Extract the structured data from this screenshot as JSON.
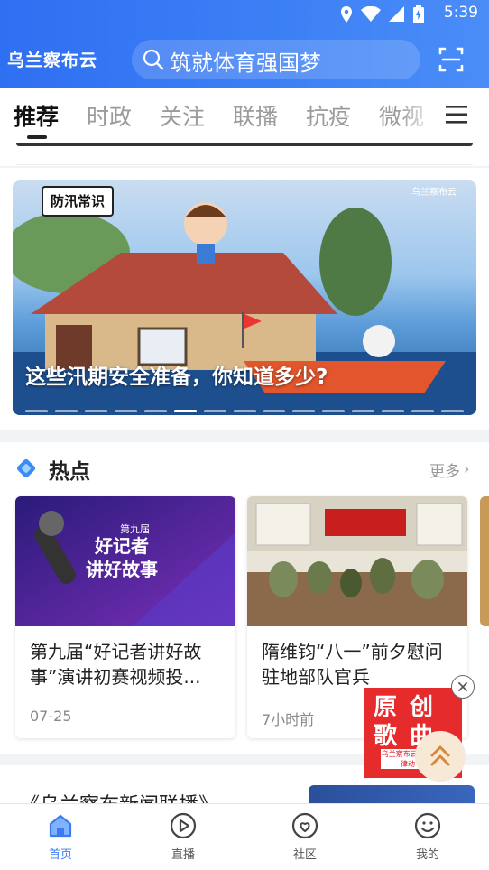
{
  "status_bar": {
    "time": "5:39"
  },
  "header": {
    "logo": "乌兰察布云",
    "search_placeholder": "筑就体育强国梦"
  },
  "tabs": [
    {
      "label": "推荐",
      "active": true
    },
    {
      "label": "时政",
      "active": false
    },
    {
      "label": "关注",
      "active": false
    },
    {
      "label": "联播",
      "active": false
    },
    {
      "label": "抗疫",
      "active": false
    },
    {
      "label": "微视",
      "active": false
    }
  ],
  "carousel": {
    "caption": "这些汛期安全准备，你知道多少?",
    "badge": "防汛常识",
    "brand": "乌兰察布云",
    "slide_count": 15,
    "active_index": 5
  },
  "hot": {
    "title": "热点",
    "more": "更多",
    "cards": [
      {
        "title": "第九届“好记者讲好故事”演讲初赛视频投...",
        "time": "07-25",
        "thumb_text": [
          "第九届",
          "好记者",
          "讲好故事"
        ]
      },
      {
        "title": "隋维钧“八一”前夕慰问驻地部队官兵",
        "time": "7小时前",
        "thumb_text": []
      }
    ]
  },
  "news_item": {
    "title": "《乌兰察布新闻联播》"
  },
  "ad": {
    "text": "原创歌曲",
    "sub": "乌兰察布云 城市律动"
  },
  "bottom_nav": [
    {
      "label": "首页",
      "icon": "home-icon",
      "active": true
    },
    {
      "label": "直播",
      "icon": "play-icon",
      "active": false
    },
    {
      "label": "社区",
      "icon": "community-icon",
      "active": false
    },
    {
      "label": "我的",
      "icon": "profile-icon",
      "active": false
    }
  ],
  "colors": {
    "brand_blue": "#3a7bf2",
    "ad_red": "#e52b2b"
  }
}
